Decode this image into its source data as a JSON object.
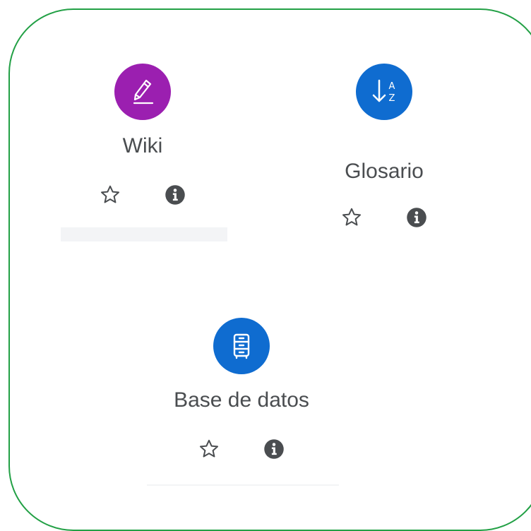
{
  "activities": [
    {
      "name": "Wiki",
      "icon": "wiki-pencil-icon",
      "color": "#9b1fb0"
    },
    {
      "name": "Glosario",
      "icon": "glossary-sort-az-icon",
      "color": "#0f6cd0"
    },
    {
      "name": "Base de datos",
      "icon": "database-cabinet-icon",
      "color": "#0f6cd0"
    }
  ],
  "glossary_icon_letters": {
    "top": "A",
    "bottom": "Z"
  },
  "actions": {
    "star_icon": "star-outline-icon",
    "info_icon": "info-icon"
  },
  "colors": {
    "border": "#22a045",
    "text": "#4a4d50",
    "action_icon": "#4a4d50"
  }
}
